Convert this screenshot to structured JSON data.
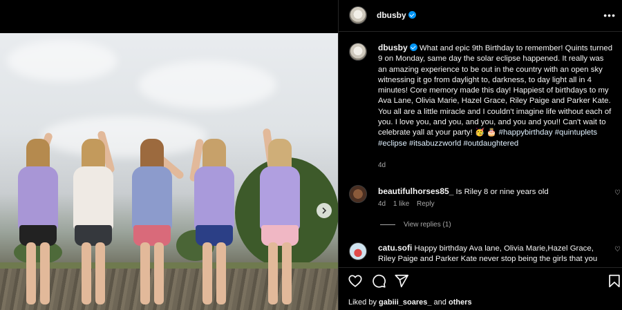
{
  "post": {
    "username": "dbusby",
    "caption": {
      "username": "dbusby",
      "text": "What and epic 9th Birthday to remember! Quints turned 9 on Monday, same day the solar eclipse happened. It really was an amazing experience to be out in the country with an open sky witnessing it go from daylight to, darkness, to day light all in 4 minutes! Core memory made this day! Happiest of birthdays to my Ava Lane, Olivia Marie, Hazel Grace, Riley Paige and Parker Kate. You all are a little miracle and I couldn't imagine life without each of you. I love you, and you, and you, and you and you!! Can't wait to celebrate yall at your party!",
      "emoji": "🥳 🎂",
      "hashtags": "#happybirthday #quintuplets #eclipse #itsabuzzworld #outdaughtered",
      "time": "4d"
    },
    "comments": [
      {
        "username": "beautifulhorses85_",
        "text": "Is Riley 8 or nine years old",
        "time": "4d",
        "likes": "1 like",
        "reply": "Reply",
        "view_replies": "View replies (1)"
      },
      {
        "username": "catu.sofi",
        "text": "Happy birthday Ava lane, Olivia Marie,Hazel Grace, Riley Paige and Parker Kate never stop being the girls that you"
      }
    ],
    "liked_by": {
      "prefix": "Liked by",
      "user": "gabiii_soares_",
      "middle": "and",
      "others": "others"
    }
  },
  "icons": {
    "more": "more-options-icon",
    "like": "heart-icon",
    "comment": "comment-icon",
    "share": "share-icon",
    "save": "bookmark-icon",
    "next": "chevron-right-icon"
  },
  "colors": {
    "background": "#000000",
    "text": "#f5f5f5",
    "secondary": "#a8a8a8",
    "verified": "#0095f6",
    "hashtag": "#e0f1ff"
  }
}
